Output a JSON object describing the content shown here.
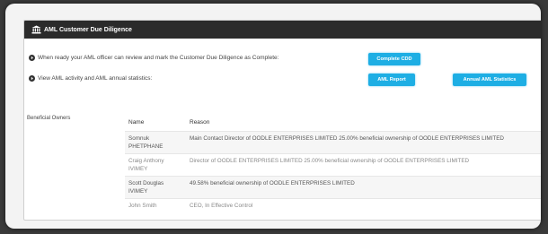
{
  "panel": {
    "title": "AML Customer Due Diligence"
  },
  "complete_row": {
    "text": "When ready your AML officer can review and mark the Customer Due Diligence as Complete:",
    "button": "Complete CDD"
  },
  "activity_row": {
    "text": "View AML activity and AML annual statistics:",
    "report_button": "AML Report",
    "stats_button": "Annual AML Statistics"
  },
  "beneficial": {
    "label": "Beneficial Owners",
    "headers": [
      "Name",
      "Reason"
    ],
    "rows": [
      {
        "name": "Somnuk PHETPHANE",
        "reason": "Main Contact Director of OODLE ENTERPRISES LIMITED 25.00% beneficial ownership of OODLE ENTERPRISES LIMITED"
      },
      {
        "name": "Craig Anthony IVIMEY",
        "reason": "Director of OODLE ENTERPRISES LIMITED 25.00% beneficial ownership of OODLE ENTERPRISES LIMITED"
      },
      {
        "name": "Scott Douglas IVIMEY",
        "reason": "49.58% beneficial ownership of OODLE ENTERPRISES LIMITED"
      },
      {
        "name": "John Smith",
        "reason": "CEO, In Effective Control"
      }
    ]
  },
  "colors": {
    "header_bg": "#2b2b2b",
    "button": "#1eaee4"
  },
  "icons": [
    "bank-icon",
    "arrow-circle-icon"
  ]
}
